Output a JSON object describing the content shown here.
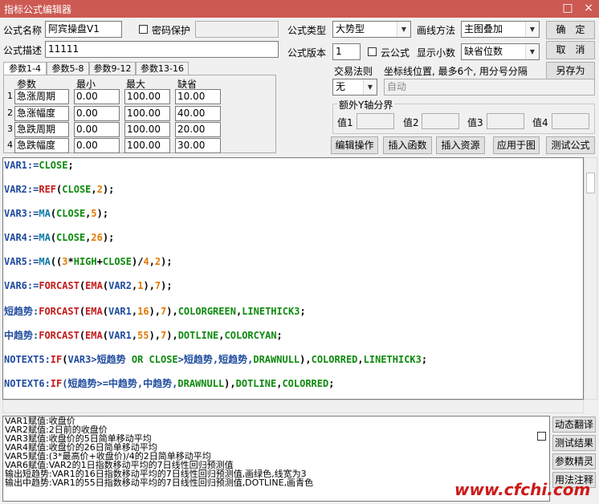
{
  "window": {
    "title": "指标公式编辑器",
    "minimize": "□",
    "close": "×"
  },
  "form": {
    "name_label": "公式名称",
    "name_value": "阿宾操盘V1",
    "password_label": "密码保护",
    "type_label": "公式类型",
    "type_value": "大势型",
    "draw_label": "画线方法",
    "draw_value": "主图叠加",
    "desc_label": "公式描述",
    "desc_value": "11111",
    "version_label": "公式版本",
    "version_value": "1",
    "cloud_label": "云公式",
    "decimal_label": "显示小数",
    "decimal_value": "缺省位数"
  },
  "buttons": {
    "ok": "确　定",
    "cancel": "取　消",
    "save_as": "另存为",
    "edit_op": "编辑操作",
    "insert_func": "插入函数",
    "insert_res": "插入资源",
    "apply_chart": "应用于图",
    "test_formula": "测试公式",
    "dyn_translate": "动态翻译",
    "test_result": "测试结果",
    "param_wizard": "参数精灵",
    "usage_notes": "用法注释"
  },
  "params": {
    "tabs": [
      "参数1-4",
      "参数5-8",
      "参数9-12",
      "参数13-16"
    ],
    "headers": [
      "参数",
      "最小",
      "最大",
      "缺省"
    ],
    "rows": [
      {
        "idx": "1",
        "name": "急涨周期",
        "min": "0.00",
        "max": "100.00",
        "def": "10.00"
      },
      {
        "idx": "2",
        "name": "急涨幅度",
        "min": "0.00",
        "max": "100.00",
        "def": "40.00"
      },
      {
        "idx": "3",
        "name": "急跌周期",
        "min": "0.00",
        "max": "100.00",
        "def": "20.00"
      },
      {
        "idx": "4",
        "name": "急跌幅度",
        "min": "0.00",
        "max": "100.00",
        "def": "30.00"
      }
    ]
  },
  "trade": {
    "label": "交易法则",
    "value": "无",
    "coord_label": "坐标线位置, 最多6个, 用分号分隔",
    "coord_placeholder": "自动"
  },
  "yaxis": {
    "label": "额外Y轴分界",
    "v1": "值1",
    "v2": "值2",
    "v3": "值3",
    "v4": "值4"
  },
  "code_lines": [
    [
      [
        "VAR1:=",
        "kw"
      ],
      [
        "CLOSE",
        "st"
      ],
      [
        ";",
        ""
      ]
    ],
    [
      [
        "VAR2:=",
        "kw"
      ],
      [
        "REF",
        "fn"
      ],
      [
        "(",
        ""
      ],
      [
        "CLOSE",
        "st"
      ],
      [
        ",",
        ""
      ],
      [
        "2",
        "num"
      ],
      [
        ");",
        ""
      ]
    ],
    [
      [
        "VAR3:=",
        "kw"
      ],
      [
        "MA",
        "fn2"
      ],
      [
        "(",
        ""
      ],
      [
        "CLOSE",
        "st"
      ],
      [
        ",",
        ""
      ],
      [
        "5",
        "num"
      ],
      [
        ");",
        ""
      ]
    ],
    [
      [
        "VAR4:=",
        "kw"
      ],
      [
        "MA",
        "fn2"
      ],
      [
        "(",
        ""
      ],
      [
        "CLOSE",
        "st"
      ],
      [
        ",",
        ""
      ],
      [
        "26",
        "num"
      ],
      [
        ");",
        ""
      ]
    ],
    [
      [
        "VAR5:=",
        "kw"
      ],
      [
        "MA",
        "fn2"
      ],
      [
        "((",
        ""
      ],
      [
        "3",
        "num"
      ],
      [
        "*",
        ""
      ],
      [
        "HIGH",
        "st"
      ],
      [
        "+",
        ""
      ],
      [
        "CLOSE",
        "st"
      ],
      [
        ")/",
        ""
      ],
      [
        "4",
        "num"
      ],
      [
        ",",
        ""
      ],
      [
        "2",
        "num"
      ],
      [
        ");",
        ""
      ]
    ],
    [
      [
        "VAR6:=",
        "kw"
      ],
      [
        "FORCAST",
        "fn"
      ],
      [
        "(",
        ""
      ],
      [
        "EMA",
        "fn"
      ],
      [
        "(",
        ""
      ],
      [
        "VAR2",
        "kw"
      ],
      [
        ",",
        ""
      ],
      [
        "1",
        "num"
      ],
      [
        "),",
        ""
      ],
      [
        "7",
        "num"
      ],
      [
        ");",
        ""
      ]
    ],
    [
      [
        "短趋势:",
        "kw"
      ],
      [
        "FORCAST",
        "fn"
      ],
      [
        "(",
        ""
      ],
      [
        "EMA",
        "fn"
      ],
      [
        "(",
        ""
      ],
      [
        "VAR1",
        "kw"
      ],
      [
        ",",
        ""
      ],
      [
        "16",
        "num"
      ],
      [
        "),",
        ""
      ],
      [
        "7",
        "num"
      ],
      [
        "),",
        ""
      ],
      [
        "COLORGREEN",
        "st"
      ],
      [
        ",",
        ""
      ],
      [
        "LINETHICK3",
        "st"
      ],
      [
        ";",
        ""
      ]
    ],
    [
      [
        "中趋势:",
        "kw"
      ],
      [
        "FORCAST",
        "fn"
      ],
      [
        "(",
        ""
      ],
      [
        "EMA",
        "fn"
      ],
      [
        "(",
        ""
      ],
      [
        "VAR1",
        "kw"
      ],
      [
        ",",
        ""
      ],
      [
        "55",
        "num"
      ],
      [
        "),",
        ""
      ],
      [
        "7",
        "num"
      ],
      [
        "),",
        ""
      ],
      [
        "DOTLINE",
        "st"
      ],
      [
        ",",
        ""
      ],
      [
        "COLORCYAN",
        "st"
      ],
      [
        ";",
        ""
      ]
    ],
    [
      [
        "NOTEXT5:",
        "kw"
      ],
      [
        "IF",
        "fn"
      ],
      [
        "(",
        ""
      ],
      [
        "VAR3",
        "kw"
      ],
      [
        ">短趋势 ",
        "kw"
      ],
      [
        "OR ",
        "st"
      ],
      [
        "CLOSE",
        "st"
      ],
      [
        ">短趋势,短趋势,",
        "kw"
      ],
      [
        "DRAWNULL",
        "st"
      ],
      [
        "),",
        ""
      ],
      [
        "COLORRED",
        "st"
      ],
      [
        ",",
        ""
      ],
      [
        "LINETHICK3",
        "st"
      ],
      [
        ";",
        ""
      ]
    ],
    [
      [
        "NOTEXT6:",
        "kw"
      ],
      [
        "IF",
        "fn"
      ],
      [
        "(短趋势>=中趋势,中趋势,",
        "kw"
      ],
      [
        "DRAWNULL",
        "st"
      ],
      [
        "),",
        ""
      ],
      [
        "DOTLINE",
        "st"
      ],
      [
        ",",
        ""
      ],
      [
        "COLORRED",
        "st"
      ],
      [
        ";",
        ""
      ]
    ]
  ],
  "output_lines": [
    "VAR1赋值:收盘价",
    "VAR2赋值:2日前的收盘价",
    "VAR3赋值:收盘价的5日简单移动平均",
    "VAR4赋值:收盘价的26日简单移动平均",
    "VAR5赋值:(3*最高价+收盘价)/4的2日简单移动平均",
    "VAR6赋值:VAR2的1日指数移动平均的7日线性回归预测值",
    "输出短趋势:VAR1的16日指数移动平均的7日线性回归预测值,画绿色,线宽为3",
    "输出中趋势:VAR1的55日指数移动平均的7日线性回归预测值,DOTLINE,画青色"
  ],
  "watermark": "www.cfchi.com"
}
